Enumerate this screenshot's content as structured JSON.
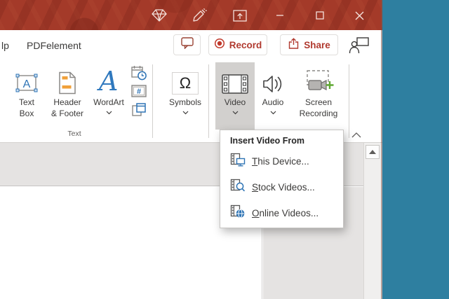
{
  "titlebar": {
    "icons": [
      "gem-icon",
      "draw-marker-icon",
      "popout-window-icon",
      "minimize-icon",
      "maximize-icon",
      "close-icon"
    ]
  },
  "tab_row": {
    "help_tab_partial": "lp",
    "pdfelement_tab": "PDFelement",
    "record_label": "Record",
    "share_label": "Share"
  },
  "ribbon": {
    "textbox_line1": "Text",
    "textbox_line2": "Box",
    "headerfooter_line1": "Header",
    "headerfooter_line2": "& Footer",
    "wordart_label": "WordArt",
    "text_group_label": "Text",
    "symbols_label": "Symbols",
    "omega_glyph": "Ω",
    "video_label": "Video",
    "audio_label": "Audio",
    "screenrec_line1": "Screen",
    "screenrec_line2": "Recording"
  },
  "menu": {
    "header": "Insert Video From",
    "items": [
      {
        "icon": "video-from-device-icon",
        "first": "T",
        "rest": "his Device..."
      },
      {
        "icon": "stock-videos-icon",
        "first": "S",
        "rest": "tock Videos..."
      },
      {
        "icon": "online-videos-icon",
        "first": "O",
        "rest": "nline Videos..."
      }
    ]
  },
  "colors": {
    "titlebar_red": "#a43a29",
    "desktop_teal": "#2e7fa0",
    "office_red": "#b0392e",
    "icon_blue": "#2e74b5",
    "icon_orange": "#f0a03a",
    "green_plus": "#5fa832",
    "pressed_button_gray": "#d2d0ce"
  }
}
